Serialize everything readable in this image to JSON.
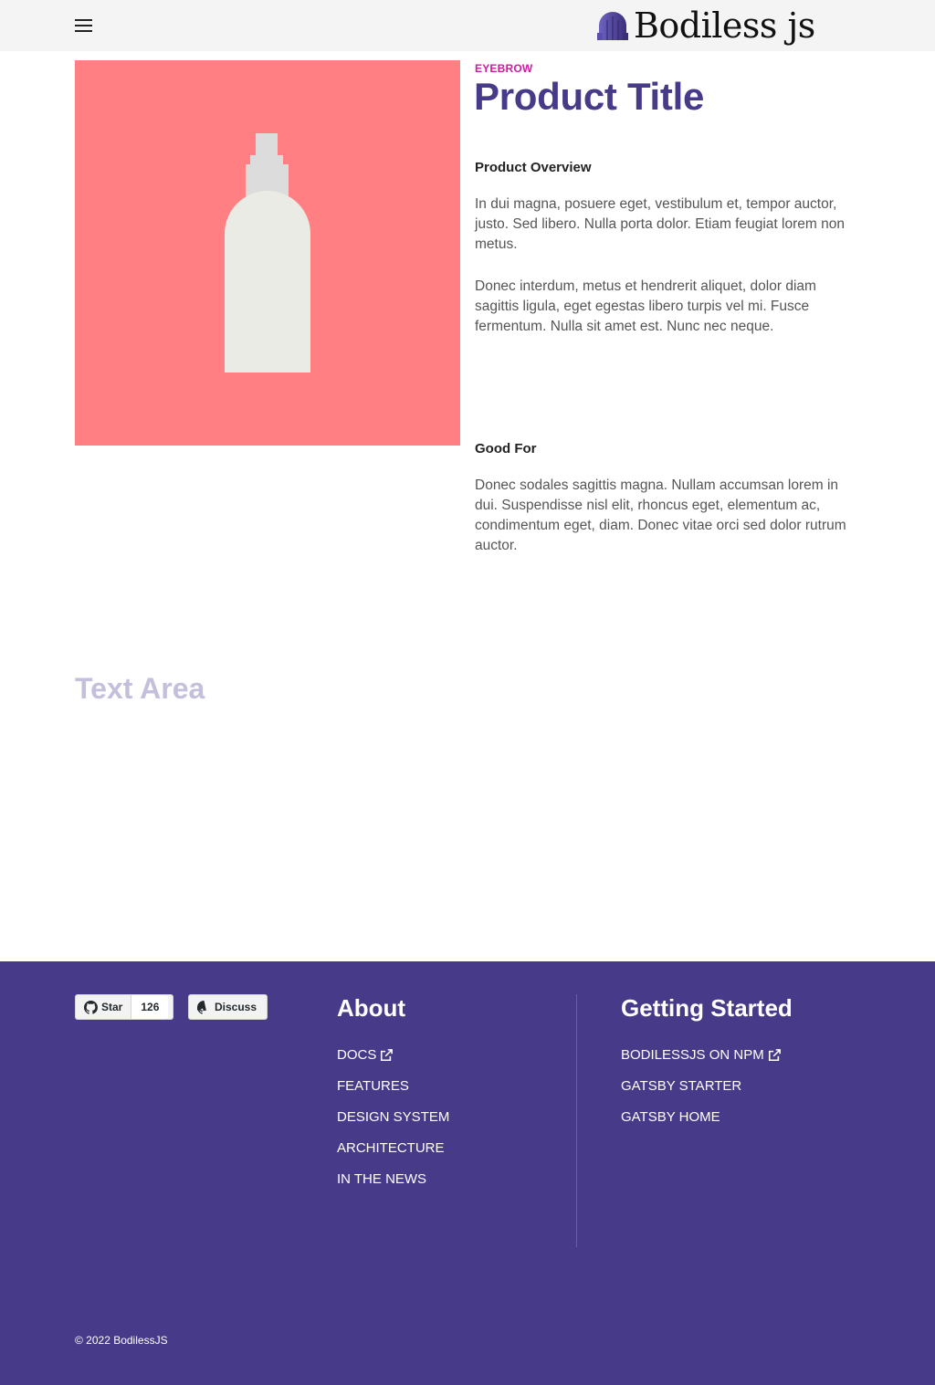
{
  "header": {
    "menu_icon": "hamburger-menu-icon",
    "logo_icon": "bodiless-logo-icon",
    "logo_text": "Bodiless js"
  },
  "product": {
    "image_icon": "spray-bottle-icon",
    "image_background": "#ff7f82",
    "eyebrow": "EYEBROW",
    "title": "Product Title",
    "overview_heading": "Product Overview",
    "overview_paragraphs": [
      "In dui magna, posuere eget, vestibulum et, tempor auctor, justo. Sed libero. Nulla porta dolor. Etiam feugiat lorem non metus.",
      "Donec interdum, metus et hendrerit aliquet, dolor diam sagittis ligula, eget egestas libero turpis vel mi. Fusce fermentum. Nulla sit amet est. Nunc nec neque."
    ],
    "good_for_heading": "Good For",
    "good_for_text": "Donec sodales sagittis magna. Nullam accumsan lorem in dui. Suspendisse nisl elit, rhoncus eget, elementum ac, condimentum eget, diam. Donec vitae orci sed dolor rutrum auctor."
  },
  "text_area": {
    "title": "Text Area"
  },
  "footer": {
    "background": "#473b89",
    "github_star": {
      "label": "Star",
      "count": "126",
      "icon": "github-icon"
    },
    "github_discuss": {
      "label": "Discuss",
      "icon": "github-icon"
    },
    "about": {
      "title": "About",
      "links": [
        {
          "label": "DOCS",
          "icon": "external-link-icon"
        },
        {
          "label": "FEATURES"
        },
        {
          "label": "DESIGN SYSTEM"
        },
        {
          "label": "ARCHITECTURE"
        },
        {
          "label": "IN THE NEWS"
        }
      ]
    },
    "getting_started": {
      "title": "Getting Started",
      "links": [
        {
          "label": "BODILESSJS ON NPM",
          "icon": "external-link-icon"
        },
        {
          "label": "GATSBY STARTER"
        },
        {
          "label": "GATSBY HOME"
        }
      ]
    },
    "copyright": "©  2022 BodilessJS"
  },
  "colors": {
    "accent_purple": "#473b89",
    "eyebrow_magenta": "#d11aa4",
    "text_area_title": "#c4c0dc"
  }
}
